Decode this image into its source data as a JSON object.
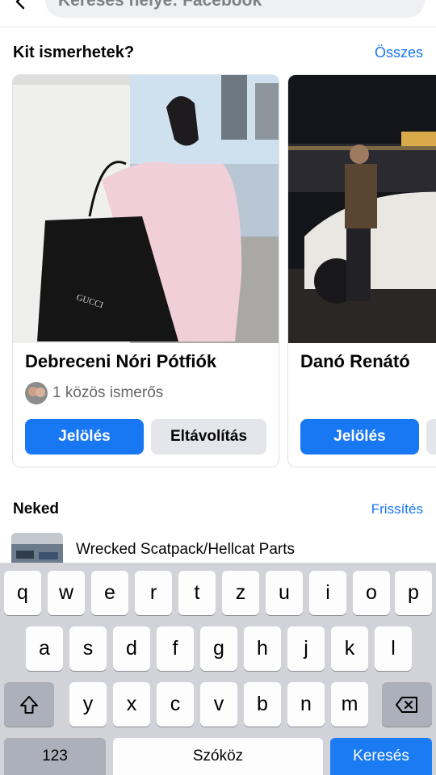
{
  "search": {
    "placeholder": "Keresés helye: Facebook"
  },
  "people": {
    "title": "Kit ismerhetek?",
    "see_all": "Összes",
    "cards": [
      {
        "name": "Debreceni Nóri Pótfiók",
        "mutual": "1 közös ismerős",
        "add_label": "Jelölés",
        "remove_label": "Eltávolítás"
      },
      {
        "name": "Danó Renátó",
        "add_label": "Jelölés"
      }
    ]
  },
  "for_you": {
    "title": "Neked",
    "refresh": "Frissítés",
    "items": [
      {
        "name": "Wrecked Scatpack/Hellcat Parts"
      }
    ]
  },
  "keyboard": {
    "row1": [
      "q",
      "w",
      "e",
      "r",
      "t",
      "z",
      "u",
      "i",
      "o",
      "p"
    ],
    "row2": [
      "a",
      "s",
      "d",
      "f",
      "g",
      "h",
      "j",
      "k",
      "l"
    ],
    "row3": [
      "y",
      "x",
      "c",
      "v",
      "b",
      "n",
      "m"
    ],
    "numbers_label": "123",
    "space_label": "Szóköz",
    "search_label": "Keresés",
    "shift_icon": "shift-arrow-icon",
    "delete_icon": "backspace-icon"
  },
  "colors": {
    "accent": "#1877f2",
    "secondary_button": "#e4e6eb",
    "keyboard_bg": "#d1d3d9"
  }
}
